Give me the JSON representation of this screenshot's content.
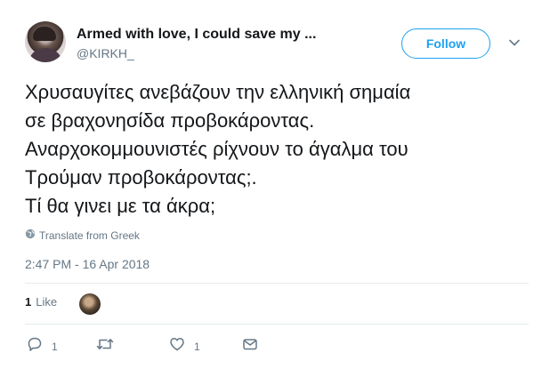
{
  "user": {
    "display_name": "Armed with love, I could save my ...",
    "handle": "@KIRKH_"
  },
  "follow_label": "Follow",
  "tweet": {
    "lines": [
      "Χρυσαυγίτες ανεβάζουν την ελληνική σημαία",
      "σε βραχονησίδα προβοκάροντας.",
      "Αναρχοκομμουνιστές ρίχνουν το άγαλμα του",
      "Τρούμαν προβοκάροντας;.",
      "Τί θα γινει με τα άκρα;"
    ],
    "translate_label": "Translate from Greek",
    "timestamp": "2:47 PM - 16 Apr 2018"
  },
  "likes": {
    "count": "1",
    "label": "Like"
  },
  "actions": {
    "reply_count": "1",
    "retweet_count": "",
    "like_count": "1"
  },
  "colors": {
    "accent": "#1da1f2",
    "text": "#14171a",
    "muted": "#657786",
    "divider": "#e6ecf0"
  },
  "icons": [
    "globe-icon",
    "caret-down-icon",
    "reply-icon",
    "retweet-icon",
    "heart-icon",
    "direct-message-icon"
  ]
}
